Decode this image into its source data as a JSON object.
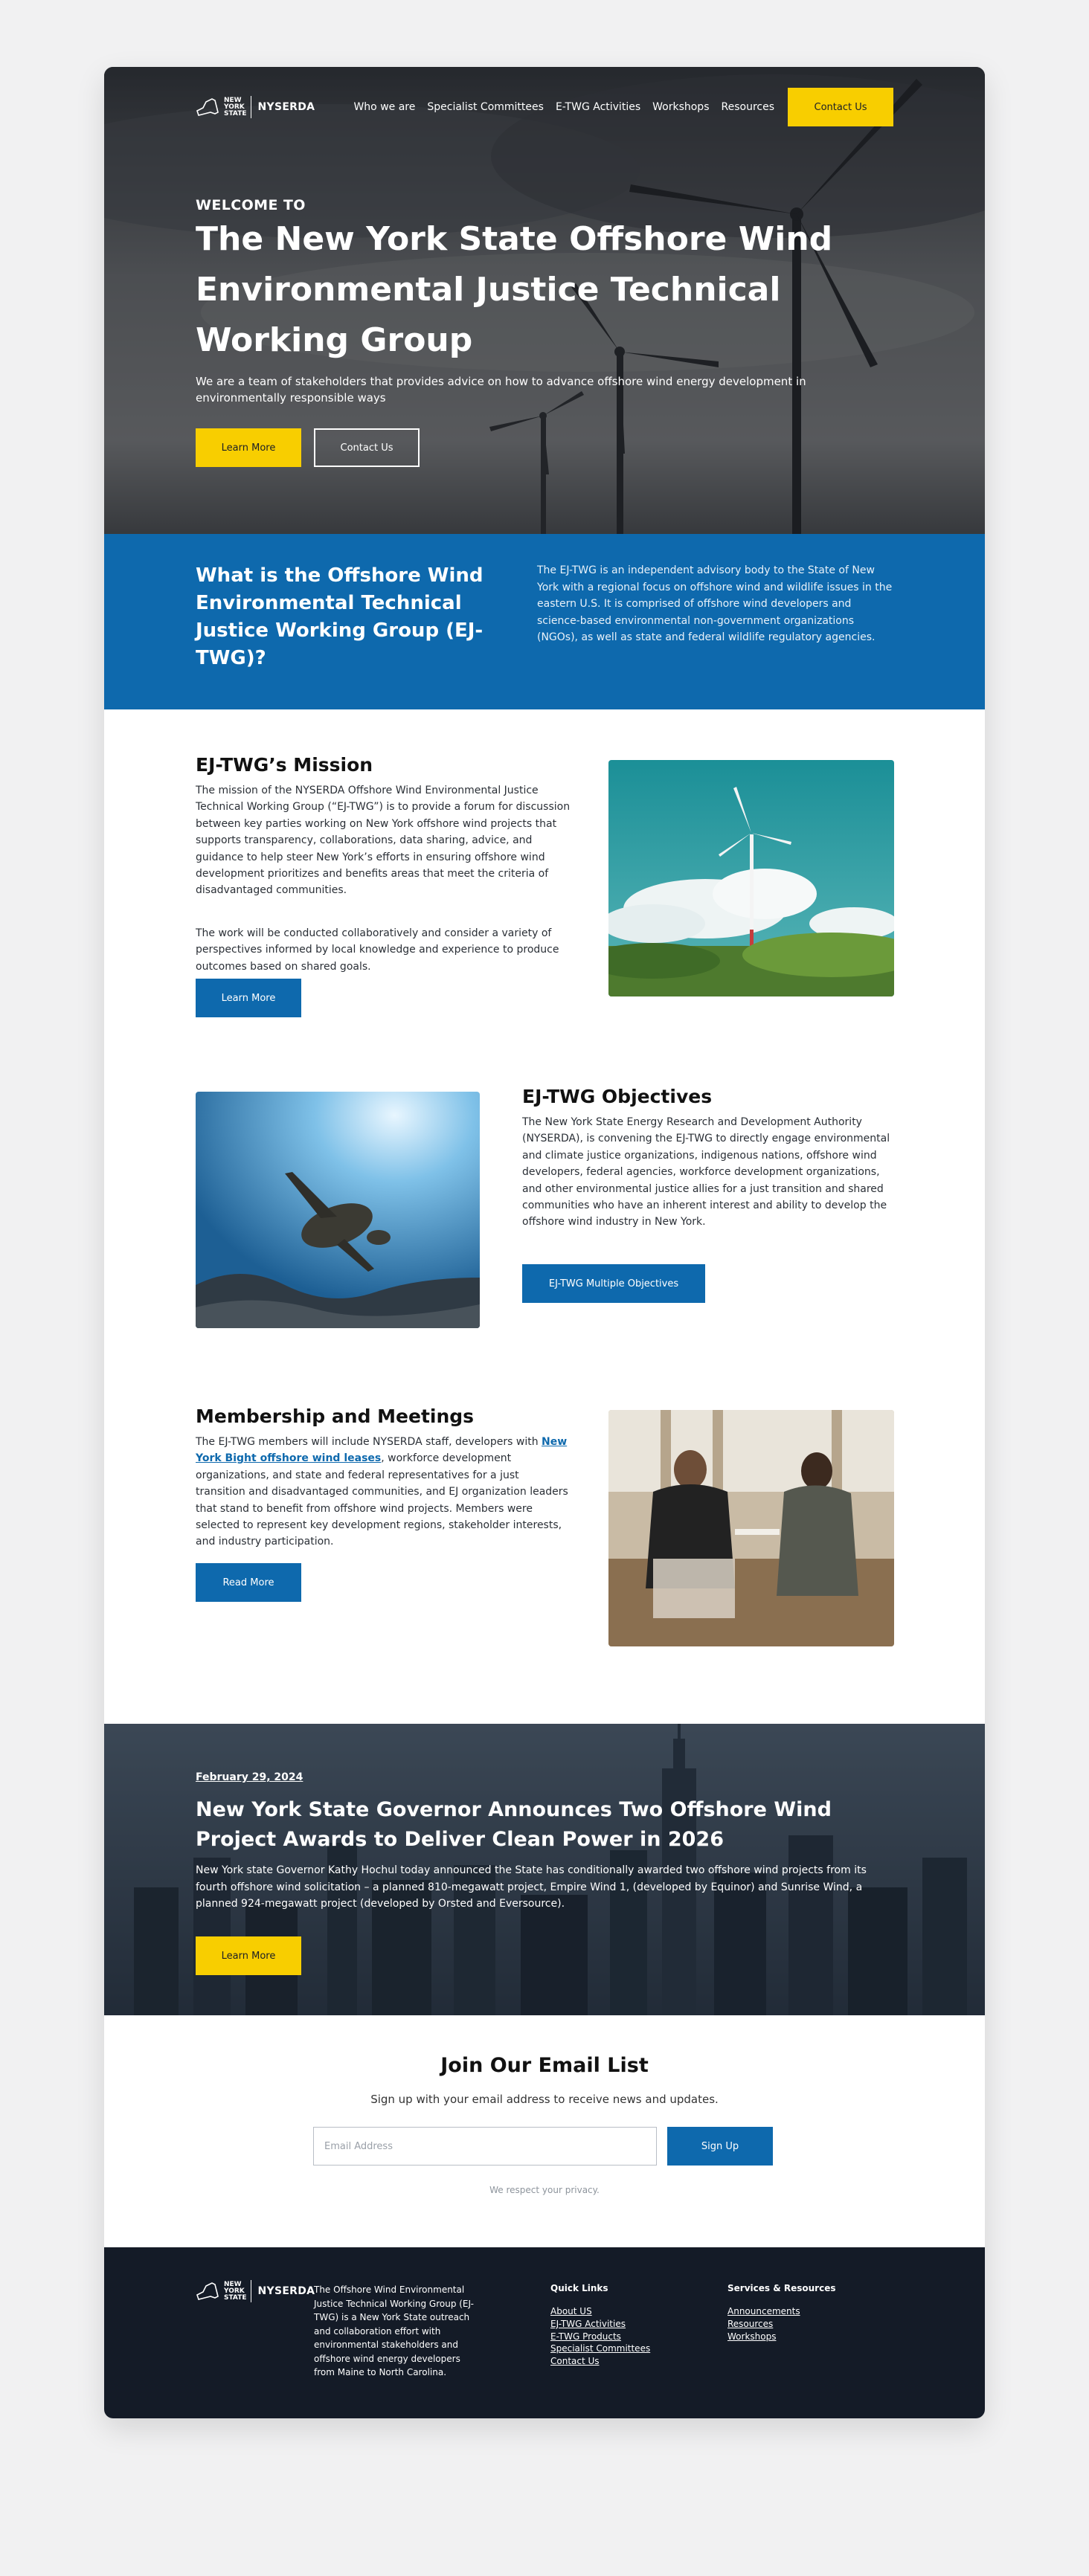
{
  "brand": {
    "logo_label": "NYSERDA",
    "state_mark": [
      "NEW",
      "YORK",
      "STATE"
    ]
  },
  "nav": {
    "links": [
      "Who we are",
      "Specialist Committees",
      "E-TWG Activities",
      "Workshops",
      "Resources"
    ],
    "contact_label": "Contact Us"
  },
  "hero": {
    "eyebrow": "WELCOME TO",
    "title": "The New York State Offshore Wind Environmental Justice Technical Working Group",
    "subtitle": "We are a team of stakeholders that provides advice on how to advance offshore wind energy development in environmentally responsible ways",
    "learn_label": "Learn More",
    "contact_label": "Contact Us"
  },
  "intro": {
    "heading": "What is the Offshore Wind Environmental Technical Justice Working Group (EJ-TWG)?",
    "body": "The EJ-TWG is an independent advisory body to the State of New York with a regional focus on offshore wind and wildlife issues in the eastern U.S. It is comprised of offshore wind developers and science-based environmental non-government organizations (NGOs), as well as state and federal wildlife regulatory agencies."
  },
  "mission": {
    "title": "EJ-TWG’s Mission",
    "para1": "The mission of the NYSERDA Offshore Wind Environmental Justice Technical Working Group (“EJ-TWG”) is to provide a forum for discussion between key parties working on New York offshore wind projects that supports transparency, collaborations, data sharing, advice, and guidance to help steer New York’s efforts in ensuring offshore wind development prioritizes and benefits areas that meet the criteria of disadvantaged communities.",
    "para2": "The work will be conducted collaboratively and consider a variety of perspectives informed by local knowledge and experience to produce outcomes based on shared goals.",
    "button_label": "Learn More"
  },
  "objectives": {
    "title": "EJ-TWG Objectives",
    "body": "The New York State Energy Research and Development Authority (NYSERDA), is convening the EJ-TWG to directly engage environmental and climate justice organizations, indigenous nations, offshore wind developers, federal agencies, workforce development organizations, and other environmental justice allies for a just transition and shared communities who have an inherent interest and ability to develop the offshore wind industry in New York.",
    "button_label": "EJ-TWG Multiple Objectives"
  },
  "membership": {
    "title": "Membership and Meetings",
    "intro": "The EJ-TWG members will include NYSERDA staff, developers with",
    "link_text": "New York Bight offshore wind leases",
    "body": ", workforce development organizations, and state and federal representatives for a just transition and disadvantaged communities, and EJ organization leaders that stand to benefit from offshore wind projects. Members were selected to represent key development regions, stakeholder interests, and industry participation.",
    "button_label": "Read More"
  },
  "news": {
    "date": "February 29, 2024",
    "title": "New York State Governor Announces Two Offshore Wind Project Awards to Deliver Clean Power in 2026",
    "body": "New York state Governor Kathy Hochul today announced the State has conditionally awarded two offshore wind projects from its fourth offshore wind solicitation – a planned 810-megawatt project, Empire Wind 1, (developed by Equinor) and Sunrise Wind, a planned 924-megawatt project (developed by Orsted and Eversource).",
    "button_label": "Learn More"
  },
  "newsletter": {
    "title": "Join Our Email List",
    "subtitle": "Sign up with your email address to receive news and updates.",
    "placeholder": "Email Address",
    "button_label": "Sign Up",
    "privacy": "We respect your privacy."
  },
  "footer": {
    "description": "The Offshore Wind Environmental Justice Technical Working Group (EJ-TWG) is a New York State outreach and collaboration effort with environmental stakeholders and offshore wind energy developers from Maine to North Carolina.",
    "quick_links_title": "Quick Links",
    "quick_links": [
      "About US",
      "EJ-TWG Activities",
      "E-TWG Products",
      "Specialist Committees",
      "Contact Us"
    ],
    "services_title": "Services & Resources",
    "services": [
      "Announcements",
      "Resources",
      "Workshops"
    ]
  },
  "colors": {
    "brand_blue": "#0e69ad",
    "accent_yellow": "#f8ce00",
    "footer_navy": "#141b27"
  }
}
